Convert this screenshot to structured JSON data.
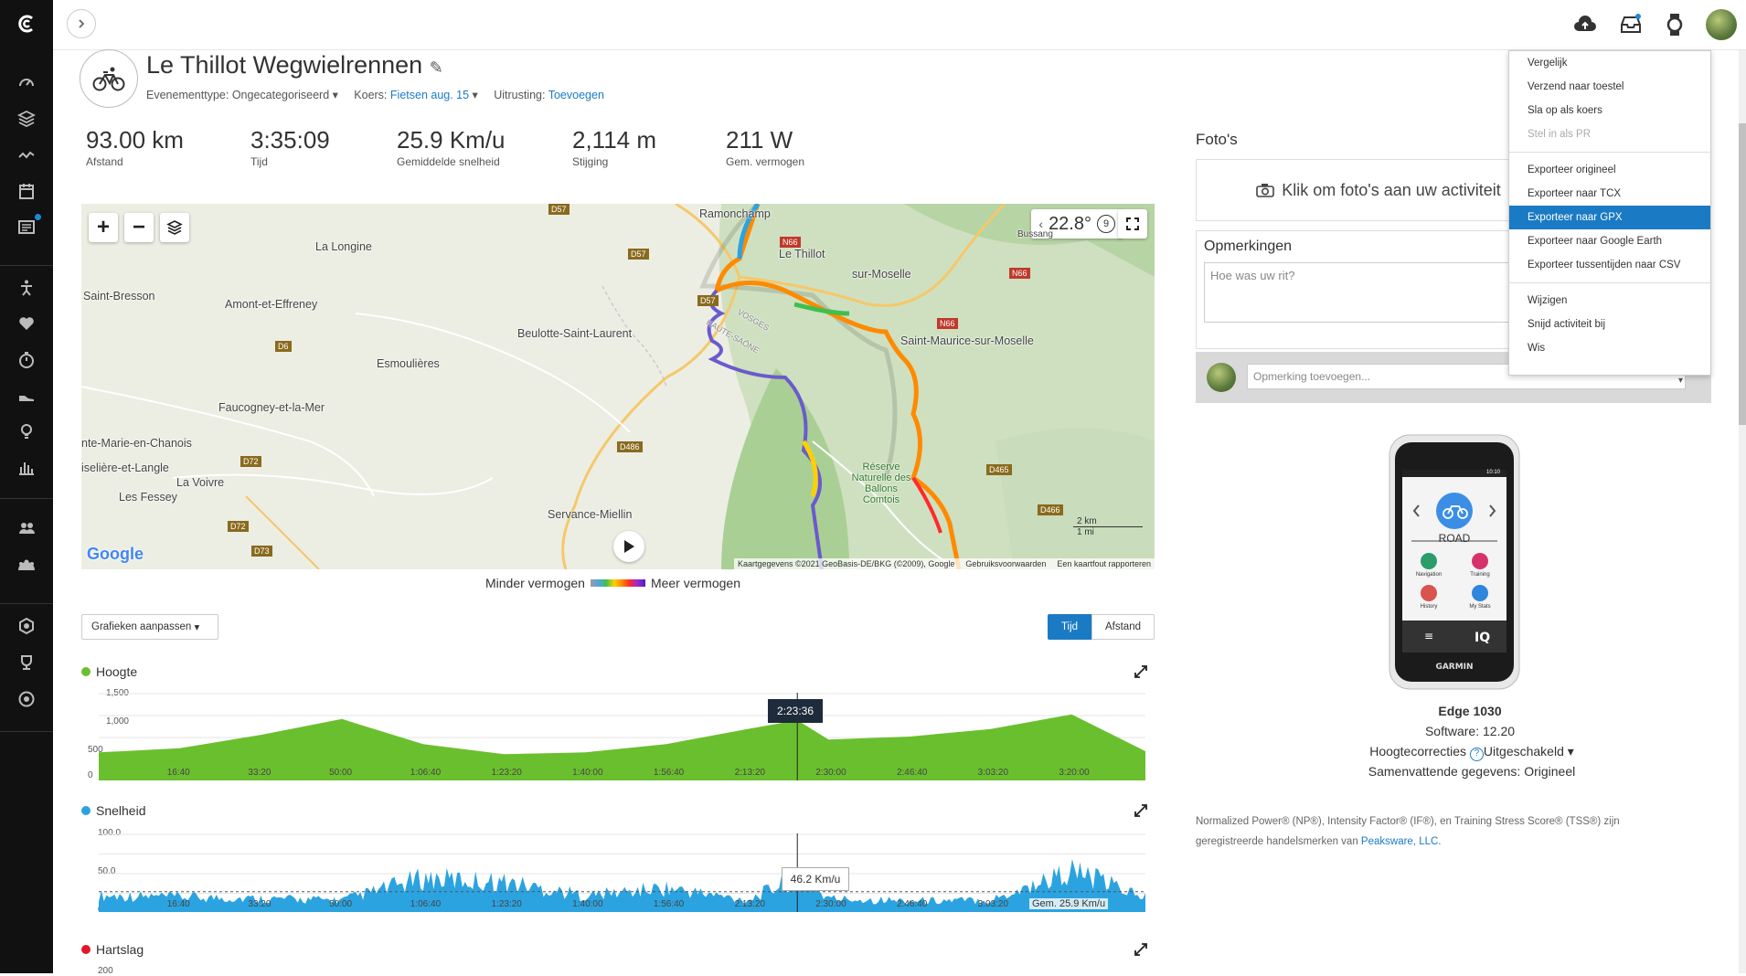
{
  "activity": {
    "title": "Le Thillot Wegwielrennen",
    "event_type_label": "Evenementtype:",
    "event_type_value": "Ongecategoriseerd",
    "course_label": "Koers:",
    "course_value": "Fietsen aug. 15",
    "gear_label": "Uitrusting:",
    "gear_value": "Toevoegen"
  },
  "stats": [
    {
      "value": "93.00 km",
      "label": "Afstand"
    },
    {
      "value": "3:35:09",
      "label": "Tijd"
    },
    {
      "value": "25.9 Km/u",
      "label": "Gemiddelde snelheid"
    },
    {
      "value": "2,114 m",
      "label": "Stijging"
    },
    {
      "value": "211 W",
      "label": "Gem. vermogen"
    }
  ],
  "map": {
    "temperature": "22.8°",
    "temp_badge": "9",
    "labels": [
      "Ramonchamp",
      "La Longine",
      "Le Thillot",
      "sur-Moselle",
      "Saint-Bresson",
      "Amont-et-Effreney",
      "Beulotte-Saint-Laurent",
      "Saint-Maurice-sur-Moselle",
      "Esmoulières",
      "Faucogney-et-la-Mer",
      "nte-Marie-en-Chanois",
      "iselière-et-Langle",
      "La Voivre",
      "Les Fessey",
      "Servance-Miellin",
      "Réserve Naturelle des Ballons Comtois",
      "VOSGES",
      "HAUTE-SAÔNE",
      "Bussang"
    ],
    "roads": [
      "D57",
      "N66",
      "D57",
      "N66",
      "D57",
      "N66",
      "D6",
      "D72",
      "D486",
      "D72",
      "D73",
      "D465",
      "D466"
    ],
    "scale_km": "2 km",
    "scale_mi": "1 mi",
    "attribution": "Kaartgegevens ©2021 GeoBasis-DE/BKG (©2009), Google",
    "terms": "Gebruiksvoorwaarden",
    "report": "Een kaartfout rapporteren",
    "google": "Google"
  },
  "legend": {
    "less": "Minder vermogen",
    "more": "Meer vermogen"
  },
  "charts_controls": {
    "customize": "Grafieken aanpassen",
    "time": "Tijd",
    "distance": "Afstand"
  },
  "charts": {
    "elevation": {
      "title": "Hoogte",
      "yticks": [
        "1,500",
        "1,000",
        "500",
        "0"
      ],
      "xticks": [
        "16:40",
        "33:20",
        "50:00",
        "1:06:40",
        "1:23:20",
        "1:40:00",
        "1:56:40",
        "2:13:20",
        "2:30:00",
        "2:46:40",
        "3:03:20",
        "3:20:00"
      ],
      "cursor_label": "2:23:36"
    },
    "speed": {
      "title": "Snelheid",
      "yticks": [
        "100.0",
        "50.0",
        "0.0"
      ],
      "xticks": [
        "16:40",
        "33:20",
        "50:00",
        "1:06:40",
        "1:23:20",
        "1:40:00",
        "1:56:40",
        "2:13:20",
        "2:30:00",
        "2:46:40",
        "3:03:20",
        "3:20:00"
      ],
      "cursor_value": "46.2 Km/u",
      "avg_label": "Gem. 25.9 Km/u"
    },
    "heartrate": {
      "title": "Hartslag",
      "ytick": "200"
    }
  },
  "chart_data": [
    {
      "type": "area",
      "title": "Hoogte",
      "xlabel": "Tijd",
      "ylabel": "",
      "ylim": [
        0,
        1500
      ],
      "x": [
        "0:00",
        "16:40",
        "33:20",
        "50:00",
        "1:06:40",
        "1:23:20",
        "1:40:00",
        "1:56:40",
        "2:13:20",
        "2:23:36",
        "2:30:00",
        "2:46:40",
        "3:03:20",
        "3:20:00",
        "3:35:09"
      ],
      "values": [
        480,
        550,
        780,
        1050,
        620,
        450,
        480,
        620,
        880,
        1030,
        700,
        750,
        880,
        1130,
        500
      ]
    },
    {
      "type": "area",
      "title": "Snelheid",
      "xlabel": "Tijd",
      "ylabel": "",
      "ylim": [
        0,
        100
      ],
      "x": [
        "0:00",
        "16:40",
        "33:20",
        "50:00",
        "1:06:40",
        "1:23:20",
        "1:40:00",
        "1:56:40",
        "2:13:20",
        "2:23:36",
        "2:30:00",
        "2:46:40",
        "3:03:20",
        "3:20:00",
        "3:35:09"
      ],
      "values": [
        22,
        20,
        18,
        16,
        45,
        40,
        22,
        32,
        16,
        46.2,
        18,
        15,
        16,
        55,
        20
      ],
      "average": 25.9
    }
  ],
  "right": {
    "photos_title": "Foto's",
    "photos_cta": "Klik om foto's aan uw activiteit",
    "notes_title": "Opmerkingen",
    "notes_placeholder": "Hoe was uw rit?",
    "comment_placeholder": "Opmerking toevoegen...",
    "device_name": "Edge 1030",
    "software": "Software: 12.20",
    "elev_corr_label": "Hoogtecorrecties",
    "elev_corr_value": "Uitgeschakeld",
    "summary": "Samenvattende gegevens: Origineel",
    "footnote": "Normalized Power® (NP®), Intensity Factor® (IF®), en Training Stress Score® (TSS®) zijn geregistreerde handelsmerken van",
    "footnote_link": "Peaksware, LLC."
  },
  "device_screen": {
    "mode": "ROAD",
    "time": "10:10",
    "items": [
      "Navigation",
      "Training",
      "History",
      "My Stats"
    ],
    "brand": "GARMIN",
    "iq": "IQ"
  },
  "menu": {
    "group1": [
      "Vergelijk",
      "Verzend naar toestel",
      "Sla op als koers",
      "Stel in als PR"
    ],
    "group2": [
      "Exporteer origineel",
      "Exporteer naar TCX",
      "Exporteer naar GPX",
      "Exporteer naar Google Earth",
      "Exporteer tussentijden naar CSV"
    ],
    "group3": [
      "Wijzigen",
      "Snijd activiteit bij",
      "Wis"
    ]
  },
  "colors": {
    "accent": "#1a7bc4",
    "elevation": "#6abf2e",
    "speed": "#2ba3e0",
    "heart": "#e0182d"
  }
}
